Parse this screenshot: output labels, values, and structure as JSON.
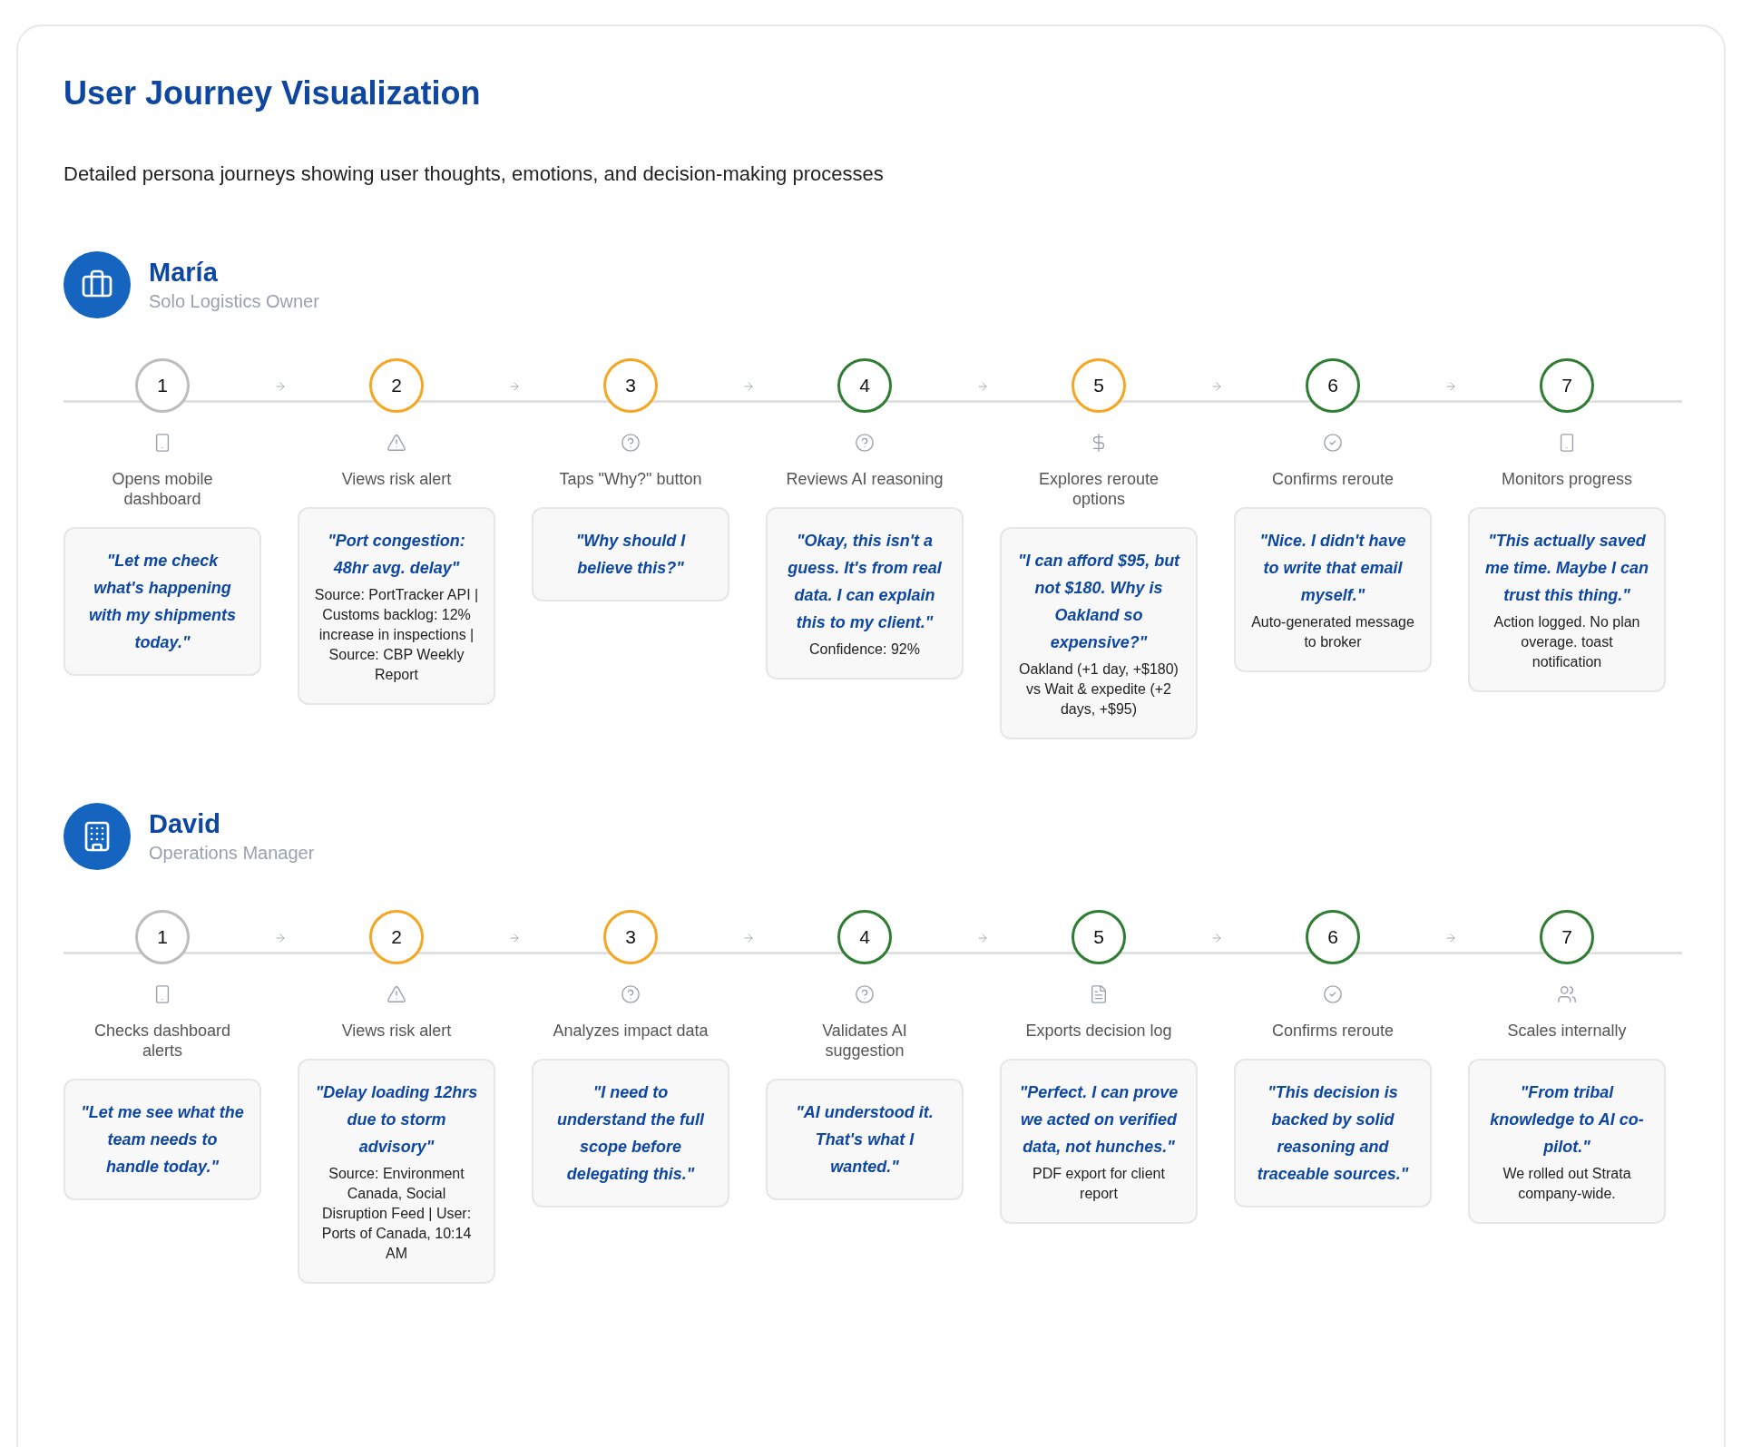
{
  "page": {
    "title": "User Journey Visualization",
    "subtitle": "Detailed persona journeys showing user thoughts, emotions, and decision-making processes"
  },
  "personas": [
    {
      "name": "María",
      "role": "Solo Logistics Owner",
      "kind": "business",
      "steps": [
        {
          "number": "1",
          "color": "#bdbdbd",
          "kind": "device",
          "label": "Opens mobile dashboard",
          "quote": "\"Let me check what's happening with my shipments today.\""
        },
        {
          "number": "2",
          "color": "#f5a623",
          "kind": "alert",
          "label": "Views risk alert",
          "quote": "\"Port congestion: 48hr avg. delay\"",
          "detail": "Source: PortTracker API | Customs backlog: 12% increase in inspections | Source: CBP Weekly Report"
        },
        {
          "number": "3",
          "color": "#f5a623",
          "kind": "question",
          "label": "Taps \"Why?\" button",
          "quote": "\"Why should I believe this?\""
        },
        {
          "number": "4",
          "color": "#2e7d32",
          "kind": "question",
          "label": "Reviews AI reasoning",
          "quote": "\"Okay, this isn't a guess. It's from real data. I can explain this to my client.\"",
          "detail": "Confidence: 92%"
        },
        {
          "number": "5",
          "color": "#f5a623",
          "kind": "cost",
          "label": "Explores reroute options",
          "quote": "\"I can afford $95, but not $180. Why is Oakland so expensive?\"",
          "detail": "Oakland (+1 day, +$180) vs Wait & expedite (+2 days, +$95)"
        },
        {
          "number": "6",
          "color": "#2e7d32",
          "kind": "confirm",
          "label": "Confirms reroute",
          "quote": "\"Nice. I didn't have to write that email myself.\"",
          "detail": "Auto-generated message to broker"
        },
        {
          "number": "7",
          "color": "#2e7d32",
          "kind": "device",
          "label": "Monitors progress",
          "quote": "\"This actually saved me time. Maybe I can trust this thing.\"",
          "detail": "Action logged. No plan overage. toast notification"
        }
      ]
    },
    {
      "name": "David",
      "role": "Operations Manager",
      "kind": "enterprise",
      "steps": [
        {
          "number": "1",
          "color": "#bdbdbd",
          "kind": "device",
          "label": "Checks dashboard alerts",
          "quote": "\"Let me see what the team needs to handle today.\""
        },
        {
          "number": "2",
          "color": "#f5a623",
          "kind": "alert",
          "label": "Views risk alert",
          "quote": "\"Delay loading 12hrs due to storm advisory\"",
          "detail": "Source: Environment Canada, Social Disruption Feed | User: Ports of Canada, 10:14 AM"
        },
        {
          "number": "3",
          "color": "#f5a623",
          "kind": "question",
          "label": "Analyzes impact data",
          "quote": "\"I need to understand the full scope before delegating this.\""
        },
        {
          "number": "4",
          "color": "#2e7d32",
          "kind": "question",
          "label": "Validates AI suggestion",
          "quote": "\"AI understood it. That's what I wanted.\""
        },
        {
          "number": "5",
          "color": "#2e7d32",
          "kind": "document",
          "label": "Exports decision log",
          "quote": "\"Perfect. I can prove we acted on verified data, not hunches.\"",
          "detail": "PDF export for client report"
        },
        {
          "number": "6",
          "color": "#2e7d32",
          "kind": "confirm",
          "label": "Confirms reroute",
          "quote": "\"This decision is backed by solid reasoning and traceable sources.\""
        },
        {
          "number": "7",
          "color": "#2e7d32",
          "kind": "team",
          "label": "Scales internally",
          "quote": "\"From tribal knowledge to AI co-pilot.\"",
          "detail": "We rolled out Strata company-wide."
        }
      ]
    }
  ]
}
